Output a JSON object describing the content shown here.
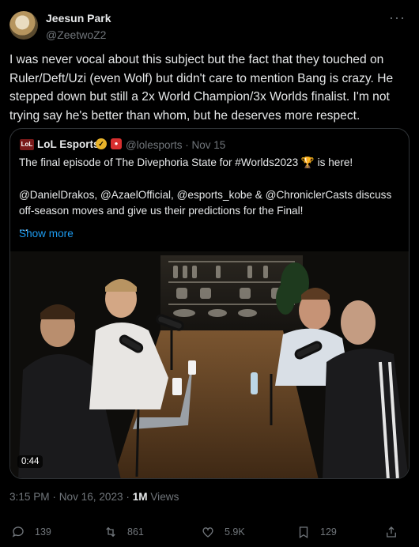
{
  "author": {
    "name": "Jeesun Park",
    "handle": "@ZeetwoZ2"
  },
  "more_icon": "more-horizontal-icon",
  "tweet_text": "I was never vocal about this subject but the fact that they touched on Ruler/Deft/Uzi (even Wolf) but didn't care to mention Bang is crazy. He stepped down but still a 2x World Champion/3x Worlds finalist. I'm not trying say he's better than whom, but he deserves more respect.",
  "quote": {
    "name": "LoL Esports",
    "handle": "@lolesports",
    "date": "Nov 15",
    "line1": "The final episode of The Divephoria State for #Worlds2023 🏆 is here!",
    "line2": "@DanielDrakos, @AzaelOfficial, @esports_kobe & @ChroniclerCasts discuss off-season moves and give us their predictions for the Final!",
    "line3": "...",
    "show_more": "Show more",
    "video_time": "0:44"
  },
  "meta": {
    "time": "3:15 PM",
    "date": "Nov 16, 2023",
    "views_count": "1M",
    "views_label": "Views"
  },
  "actions": {
    "replies": "139",
    "reposts": "861",
    "likes": "5.9K",
    "bookmarks": "129"
  },
  "colors": {
    "accent": "#1d9bf0",
    "muted": "#71767b",
    "text": "#e7e9ea",
    "background": "#000000"
  }
}
